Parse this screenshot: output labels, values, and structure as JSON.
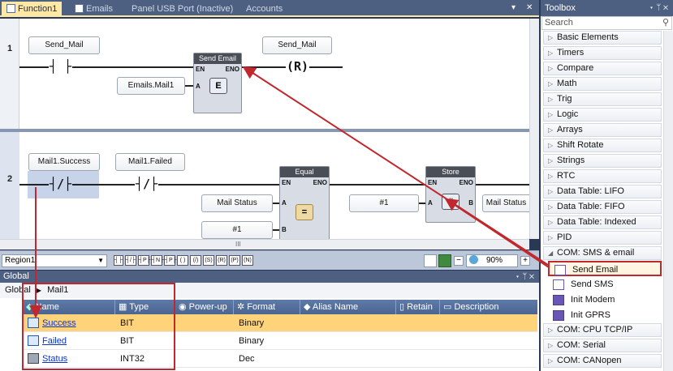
{
  "tabs": [
    {
      "label": "Function1",
      "active": true
    },
    {
      "label": "Emails",
      "active": false
    },
    {
      "label": "Panel USB Port (Inactive)",
      "active": false
    },
    {
      "label": "Accounts",
      "active": false
    }
  ],
  "tab_controls": {
    "menu": "▾",
    "close": "✕"
  },
  "ladder": {
    "rung1": {
      "number": "1",
      "contact_tag": "Send_Mail",
      "contact_symbol": "┤ ├",
      "coil_tag": "Send_Mail",
      "coil_symbol": "(R)",
      "block": {
        "title": "Send Email",
        "en": "EN",
        "eno": "ENO",
        "input_pin": "A",
        "input_tag": "Emails.Mail1"
      }
    },
    "rung2": {
      "number": "2",
      "contact1_tag": "Mail1.Success",
      "contact1_symbol": "┤/├",
      "contact2_tag": "Mail1.Failed",
      "contact2_symbol": "┤/├",
      "equal_block": {
        "title": "Equal",
        "en": "EN",
        "eno": "ENO",
        "pin_a": "A",
        "pin_b": "B",
        "tag_a": "Mail Status",
        "tag_b": "#1"
      },
      "store_block": {
        "title": "Store",
        "en": "EN",
        "eno": "ENO",
        "pin_a": "A",
        "pin_b": "B",
        "tag_a": "#1",
        "tag_b": "Mail Status"
      }
    },
    "hscroll_thumb": "III"
  },
  "ladder_bar": {
    "region": "Region1",
    "zoom": "90%",
    "element_buttons": [
      "┤├",
      "┤/├",
      "┤P├",
      "┤N├",
      "┤P├",
      "( )",
      "(/)",
      "(S)",
      "(R)",
      "(P)",
      "(N)"
    ]
  },
  "global_panel": {
    "title": "Global",
    "breadcrumb": [
      "Global",
      "Mail1"
    ],
    "columns": [
      "Name",
      "Type",
      "Power-up",
      "Format",
      "Alias Name",
      "Retain",
      "Description"
    ],
    "rows": [
      {
        "name": "Success",
        "type": "BIT",
        "format": "Binary",
        "icon": "bit-variable-icon",
        "selected": true
      },
      {
        "name": "Failed",
        "type": "BIT",
        "format": "Binary",
        "icon": "bit-variable-icon",
        "selected": false
      },
      {
        "name": "Status",
        "type": "INT32",
        "format": "Dec",
        "icon": "int-variable-icon",
        "selected": false
      }
    ]
  },
  "toolbox": {
    "title": "Toolbox",
    "search_placeholder": "Search",
    "categories": [
      "Basic Elements",
      "Timers",
      "Compare",
      "Math",
      "Trig",
      "Logic",
      "Arrays",
      "Shift Rotate",
      "Strings",
      "RTC",
      "Data Table: LIFO",
      "Data Table: FIFO",
      "Data Table: Indexed",
      "PID",
      "COM: SMS & email"
    ],
    "expanded_items": [
      "Send Email",
      "Send SMS",
      "Init Modem",
      "Init GPRS"
    ],
    "more_categories": [
      "COM: CPU TCP/IP",
      "COM: Serial",
      "COM: CANopen"
    ]
  },
  "colors": {
    "highlight": "#c0282d",
    "active_tab": "#ffe8a6",
    "selected_row": "#ffd37a",
    "panel_title": "#4d6082"
  }
}
